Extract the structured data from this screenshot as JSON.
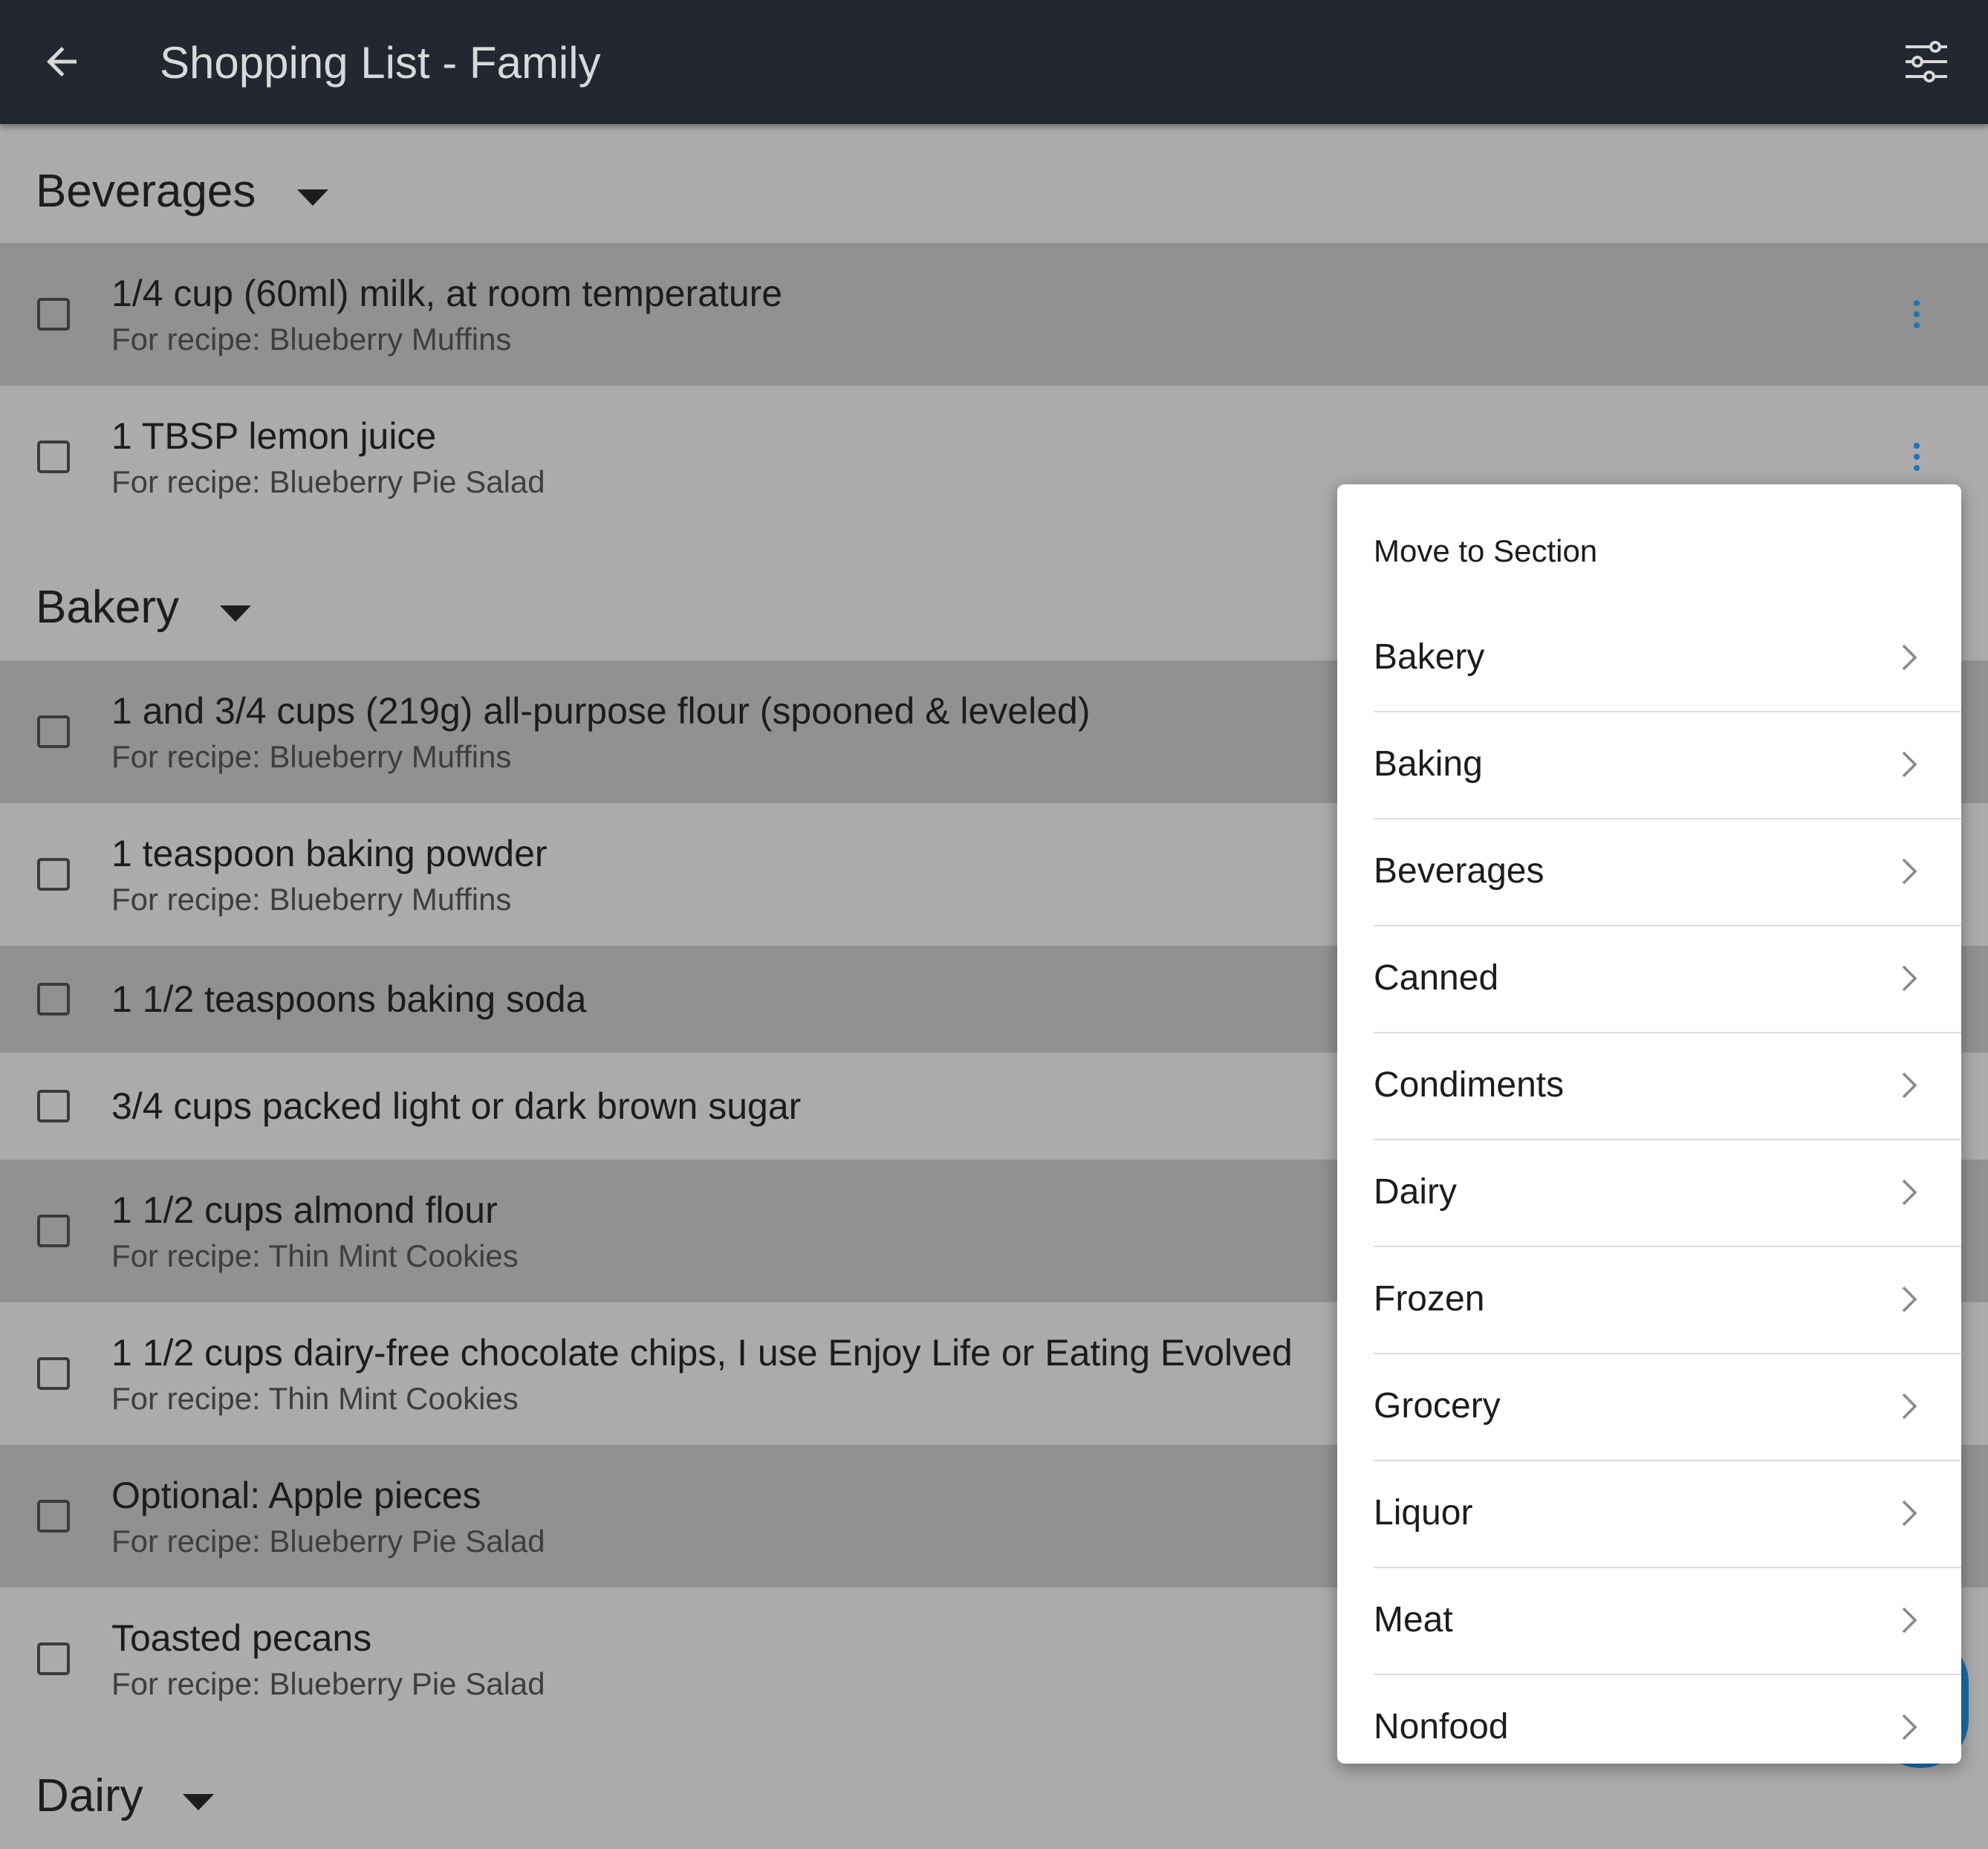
{
  "app_bar": {
    "title": "Shopping List - Family",
    "back_icon": "arrow-left-icon",
    "filter_icon": "sliders-icon"
  },
  "sections": [
    {
      "title": "Beverages",
      "items": [
        {
          "text": "1/4 cup (60ml) milk, at room temperature",
          "sub": "For recipe: Blueberry Muffins"
        },
        {
          "text": "1 TBSP lemon juice",
          "sub": "For recipe: Blueberry Pie Salad"
        }
      ]
    },
    {
      "title": "Bakery",
      "items": [
        {
          "text": "1 and 3/4 cups (219g) all-purpose flour (spooned & leveled)",
          "sub": "For recipe: Blueberry Muffins"
        },
        {
          "text": "1 teaspoon baking powder",
          "sub": "For recipe: Blueberry Muffins"
        },
        {
          "text": "1 1/2 teaspoons baking soda"
        },
        {
          "text": "3/4 cups packed light or dark brown sugar"
        },
        {
          "text": "1 1/2 cups almond flour",
          "sub": "For recipe: Thin Mint Cookies"
        },
        {
          "text": "1 1/2 cups dairy-free chocolate chips, I use Enjoy Life or Eating Evolved",
          "sub": "For recipe: Thin Mint Cookies"
        },
        {
          "text": "Optional: Apple pieces",
          "sub": "For recipe: Blueberry Pie Salad"
        },
        {
          "text": "Toasted pecans",
          "sub": "For recipe: Blueberry Pie Salad"
        }
      ]
    },
    {
      "title": "Dairy",
      "items": []
    }
  ],
  "menu": {
    "header": "Move to Section",
    "items": [
      "Bakery",
      "Baking",
      "Beverages",
      "Canned",
      "Condiments",
      "Dairy",
      "Frozen",
      "Grocery",
      "Liquor",
      "Meat",
      "Nonfood"
    ],
    "chevron_icon": "chevron-right-icon"
  },
  "colors": {
    "app_bar": "#222732",
    "background": "#ababab",
    "row_alt": "#919191",
    "accent": "#1f74b3",
    "menu_bg": "#ffffff"
  }
}
